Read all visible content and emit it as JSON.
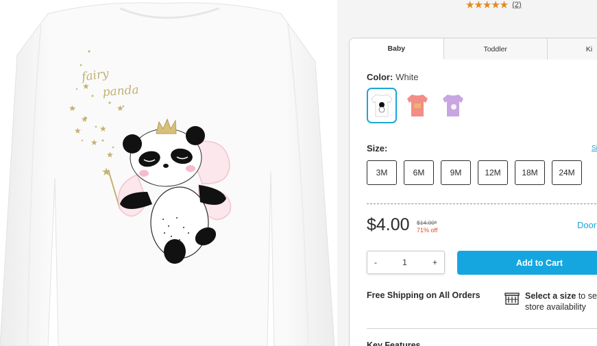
{
  "product": {
    "print_line1": "fairy",
    "print_line2": "panda"
  },
  "rating": {
    "stars": "★★★★★",
    "count": "(2)"
  },
  "tabs": [
    "Baby",
    "Toddler",
    "Ki"
  ],
  "color": {
    "label": "Color:",
    "value": "White",
    "swatches": [
      {
        "name": "White",
        "fill": "#ffffff",
        "selected": true
      },
      {
        "name": "Coral",
        "fill": "#f38d86",
        "selected": false
      },
      {
        "name": "Lavender",
        "fill": "#c7a6e2",
        "selected": false
      }
    ],
    "accent": "#1aa6d8"
  },
  "size": {
    "label": "Size:",
    "guide": "Si",
    "options": [
      "3M",
      "6M",
      "9M",
      "12M",
      "18M",
      "24M"
    ]
  },
  "price": {
    "current": "$4.00",
    "original": "$14.00*",
    "discount": "71% off",
    "door": "Door"
  },
  "quantity": {
    "minus": "-",
    "value": "1",
    "plus": "+"
  },
  "add_to_cart": "Add to Cart",
  "shipping": "Free Shipping on All Orders",
  "store": {
    "bold": "Select a size",
    "rest": " to se",
    "line2": "store availability"
  },
  "key_features": "Key Features",
  "colors": {
    "primary": "#15a6e0",
    "star": "#e08a1e",
    "discount": "#e0492d"
  }
}
